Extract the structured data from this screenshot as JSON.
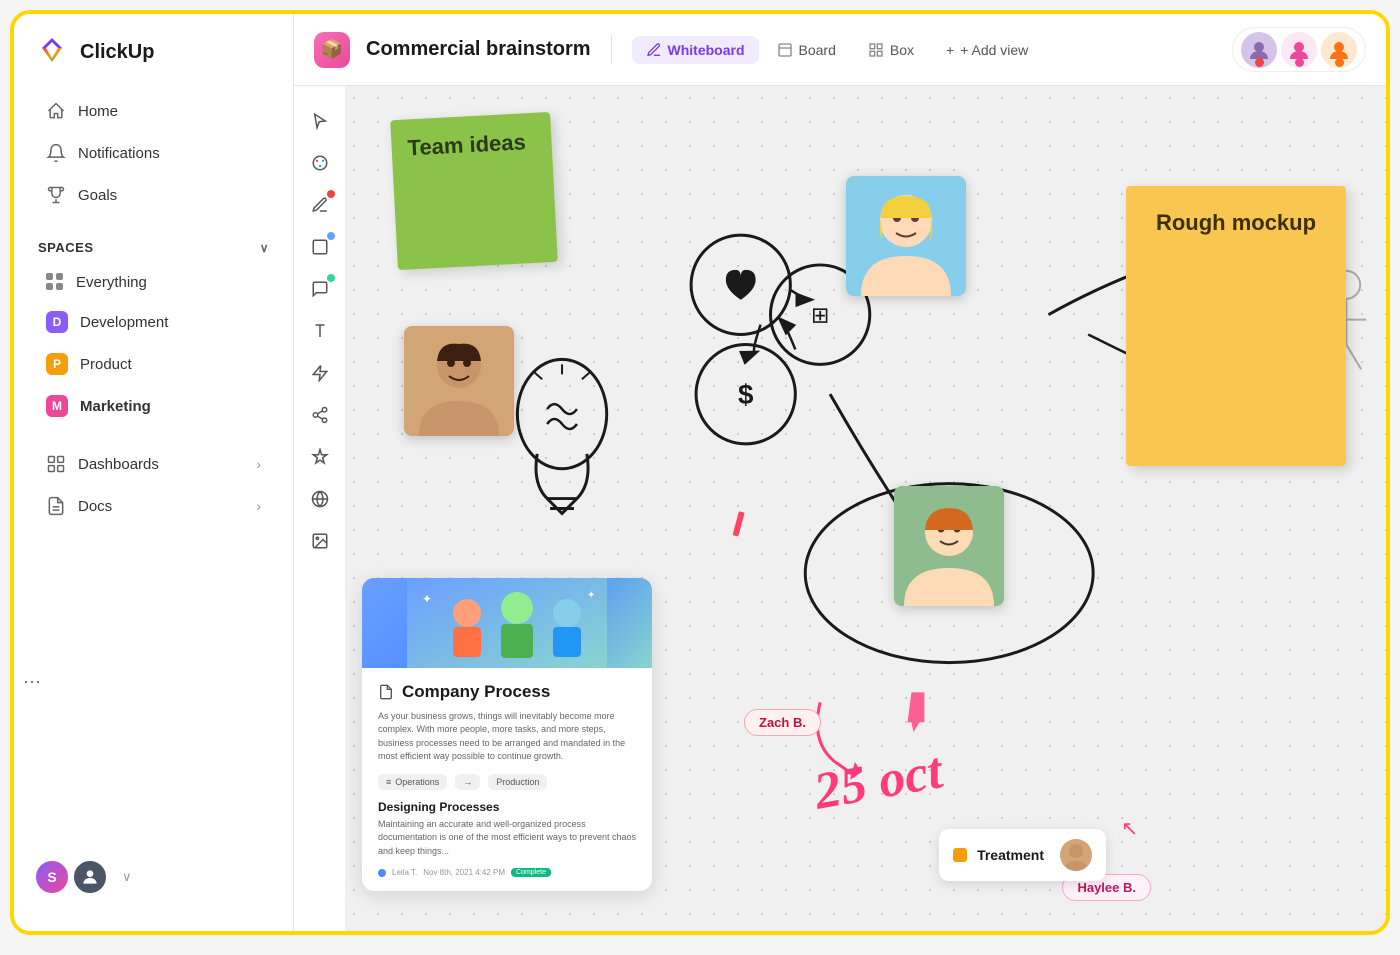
{
  "app": {
    "name": "ClickUp",
    "logo_emoji": "⬡"
  },
  "sidebar": {
    "nav": [
      {
        "id": "home",
        "label": "Home",
        "icon": "home"
      },
      {
        "id": "notifications",
        "label": "Notifications",
        "icon": "bell"
      },
      {
        "id": "goals",
        "label": "Goals",
        "icon": "trophy"
      }
    ],
    "spaces_label": "Spaces",
    "spaces": [
      {
        "id": "everything",
        "label": "Everything",
        "color": null,
        "icon": "grid"
      },
      {
        "id": "development",
        "label": "Development",
        "color": "#8B5CF6",
        "initial": "D"
      },
      {
        "id": "product",
        "label": "Product",
        "color": "#F59E0B",
        "initial": "P"
      },
      {
        "id": "marketing",
        "label": "Marketing",
        "color": "#EC4899",
        "initial": "M",
        "bold": true
      }
    ],
    "bottom_nav": [
      {
        "id": "dashboards",
        "label": "Dashboards"
      },
      {
        "id": "docs",
        "label": "Docs"
      }
    ],
    "footer": {
      "user1_initial": "S",
      "user2_initial": ""
    }
  },
  "topbar": {
    "project_icon": "📦",
    "project_title": "Commercial brainstorm",
    "views": [
      {
        "id": "whiteboard",
        "label": "Whiteboard",
        "active": true,
        "icon": "✏️"
      },
      {
        "id": "board",
        "label": "Board",
        "active": false,
        "icon": "⊟"
      },
      {
        "id": "box",
        "label": "Box",
        "active": false,
        "icon": "⊞"
      },
      {
        "id": "add_view",
        "label": "+ Add view",
        "active": false
      }
    ],
    "users": [
      {
        "color": "#FFB6B6",
        "dot": "#EF4444"
      },
      {
        "color": "#F9A8D4",
        "dot": "#EC4899"
      },
      {
        "color": "#FDE68A",
        "dot": "#F97316"
      }
    ]
  },
  "canvas": {
    "sticky_green": {
      "text": "Team ideas"
    },
    "sticky_yellow": {
      "text": "Rough mockup"
    },
    "doc_card": {
      "title": "Company Process",
      "body": "As your business grows, things will inevitably become more complex. With more people, more tasks, and more steps, business processes need to be arranged and mandated in the most efficient way possible to continue growth.",
      "tags": [
        {
          "icon": "≡",
          "label": "Operations"
        },
        {
          "arrow": "→",
          "label": "Production"
        }
      ],
      "section_title": "Designing Processes",
      "section_body": "Maintaining an accurate and well-organized process documentation is one of the most efficient ways to prevent chaos and keep things...",
      "footer_author": "Leila T.",
      "footer_date": "Nov 8th, 2021  4:42 PM",
      "footer_badge": "Complete"
    },
    "name_tags": [
      {
        "id": "zach",
        "label": "Zach B."
      },
      {
        "id": "haylee",
        "label": "Haylee B."
      }
    ],
    "treatment_card": {
      "label": "Treatment"
    },
    "oct_text": "25 oct"
  },
  "toolbar": {
    "tools": [
      {
        "id": "cursor",
        "icon": "cursor",
        "dot": null
      },
      {
        "id": "palette",
        "icon": "palette",
        "dot": null
      },
      {
        "id": "pencil",
        "icon": "pencil",
        "dot": "#EF4444"
      },
      {
        "id": "square",
        "icon": "square",
        "dot": "#60A5FA"
      },
      {
        "id": "note",
        "icon": "note",
        "dot": "#34D399"
      },
      {
        "id": "text",
        "icon": "text",
        "dot": null
      },
      {
        "id": "lightning",
        "icon": "lightning",
        "dot": null
      },
      {
        "id": "share",
        "icon": "share",
        "dot": null
      },
      {
        "id": "sparkle",
        "icon": "sparkle",
        "dot": null
      },
      {
        "id": "globe",
        "icon": "globe",
        "dot": null
      },
      {
        "id": "image",
        "icon": "image",
        "dot": null
      }
    ]
  }
}
